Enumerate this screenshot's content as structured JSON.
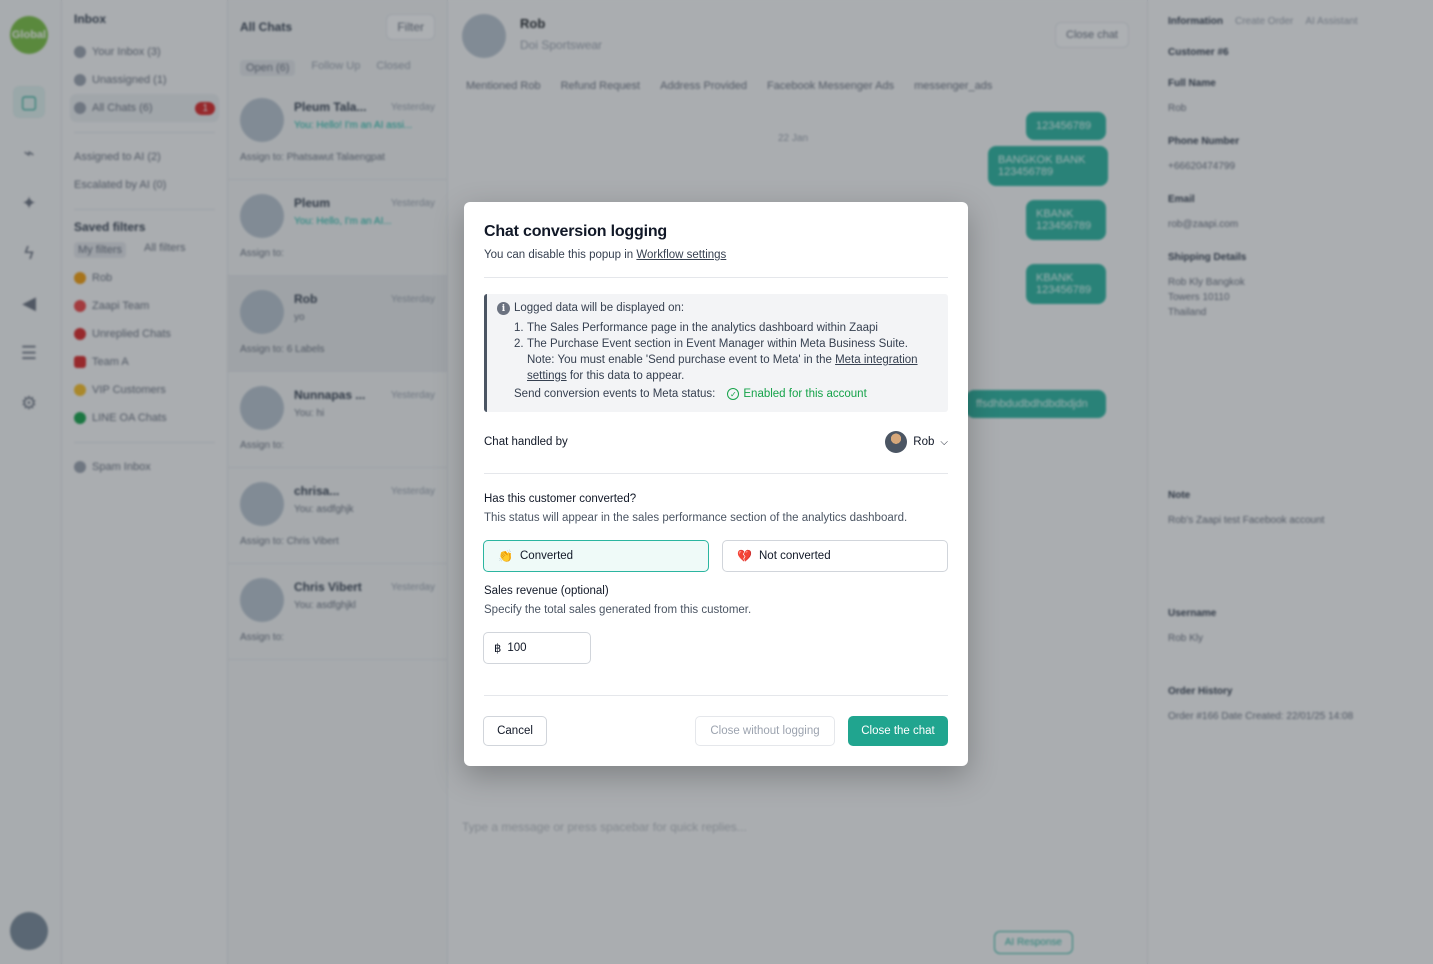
{
  "background": {
    "rail": {
      "logo": "Global"
    },
    "inbox": {
      "title": "Inbox",
      "items": [
        {
          "label": "Your Inbox (3)"
        },
        {
          "label": "Unassigned (1)"
        },
        {
          "label": "All Chats (6)",
          "badge": "1"
        },
        {
          "label": "Assigned to AI (2)"
        },
        {
          "label": "Escalated by AI (0)"
        }
      ],
      "saved_filters_title": "Saved filters",
      "filter_tabs": [
        "My filters",
        "All filters"
      ],
      "saved": [
        "Rob",
        "Zaapi Team",
        "Unreplied Chats",
        "Team A",
        "VIP Customers",
        "LINE OA Chats"
      ],
      "spam": "Spam Inbox"
    },
    "chatlist": {
      "title": "All Chats",
      "filter_label": "Filter",
      "tabs": [
        "Open (6)",
        "Follow Up",
        "Closed"
      ],
      "cards": [
        {
          "name": "Pleum Tala...",
          "time": "Yesterday",
          "preview": "You: Hello! I'm an AI assi...",
          "assign": "Assign to:  Phatsawut Talaengpat"
        },
        {
          "name": "Pleum",
          "time": "Yesterday",
          "preview": "You: Hello, I'm an AI...",
          "assign": "Assign to:"
        },
        {
          "name": "Rob",
          "time": "Yesterday",
          "preview": "yo",
          "assign": "Assign to:   6 Labels"
        },
        {
          "name": "Nunnapas ...",
          "time": "Yesterday",
          "preview": "You: hi",
          "assign": "Assign to:"
        },
        {
          "name": "chrisa...",
          "time": "Yesterday",
          "preview": "You: asdfghjk",
          "assign": "Assign to:   Chris Vibert"
        },
        {
          "name": "Chris Vibert",
          "time": "Yesterday",
          "preview": "You: asdfghjkl",
          "assign": "Assign to:"
        }
      ]
    },
    "chat": {
      "name": "Rob",
      "company": "Doi Sportswear",
      "close_label": "Close chat",
      "labels": [
        "Mentioned Rob",
        "Refund Request",
        "Address Provided",
        "Facebook Messenger Ads",
        "messenger_ads"
      ],
      "date": "22 Jan",
      "bubbles": [
        "123456789",
        "BANGKOK BANK 123456789",
        "KBANK 123456789",
        "KBANK 123456789",
        "ffsdhbdudbdhdbdbdjdn"
      ],
      "composer_placeholder": "Type a message or press spacebar for quick replies...",
      "ai_label": "AI Response"
    },
    "info": {
      "tabs": [
        "Information",
        "Create Order",
        "AI Assistant"
      ],
      "fields": [
        {
          "label": "Customer #6",
          "value": ""
        },
        {
          "label": "Full Name",
          "value": "Rob"
        },
        {
          "label": "Phone Number",
          "value": "+66620474799"
        },
        {
          "label": "Email",
          "value": "rob@zaapi.com"
        },
        {
          "label": "Shipping Details",
          "value": "Rob Kly Bangkok Towers 10110 Thailand"
        },
        {
          "label": "Note",
          "value": "Rob's Zaapi test Facebook account"
        },
        {
          "label": "Username",
          "value": "Rob Kly"
        },
        {
          "label": "Order History",
          "value": "Order #166  Date Created: 22/01/25 14:08"
        }
      ]
    }
  },
  "modal": {
    "title": "Chat conversion logging",
    "subtitle_prefix": "You can disable this popup in ",
    "subtitle_link": "Workflow settings",
    "note": {
      "heading": "Logged data will be displayed on:",
      "item1_num": "1.",
      "item1": "The Sales Performance page in the analytics dashboard within Zaapi",
      "item2_num": "2.",
      "item2": "The Purchase Event section in Event Manager within Meta Business Suite.",
      "note_prefix": "Note: You must enable 'Send purchase event to Meta' in the ",
      "note_link": "Meta integration settings",
      "note_suffix": " for this data to appear.",
      "status_label": "Send conversion events to Meta status:",
      "status_value": "Enabled for this account"
    },
    "handled_label": "Chat handled by",
    "handler_name": "Rob",
    "question": "Has this customer converted?",
    "question_desc": "This status will appear in the sales performance section of the analytics dashboard.",
    "converted_label": "Converted",
    "not_converted_label": "Not converted",
    "selected": "converted",
    "revenue_label": "Sales revenue (optional)",
    "revenue_desc": "Specify the total sales generated from this customer.",
    "currency_symbol": "฿",
    "revenue_value": "100",
    "cancel_label": "Cancel",
    "skip_label": "Close without logging",
    "confirm_label": "Close the chat",
    "colors": {
      "accent": "#20a58f",
      "enabled": "#16a34a"
    }
  }
}
